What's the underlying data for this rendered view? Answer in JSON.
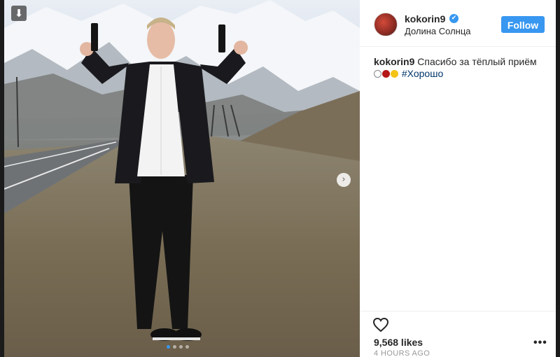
{
  "post": {
    "username": "kokorin9",
    "location": "Долина Солнца",
    "follow_label": "Follow",
    "verified_icon": "✔",
    "caption": {
      "username": "kokorin9",
      "text": "Спасибо за тёплый приём",
      "emoji": [
        "white-circle",
        "red-circle",
        "yellow-circle"
      ],
      "hashtag": "#Хорошо"
    },
    "likes": "9,568 likes",
    "timestamp": "4 HOURS AGO",
    "more_label": "•••"
  },
  "photo": {
    "save_icon": "⬇",
    "next_icon": "›",
    "carousel_dots": 4,
    "active_dot": 0
  },
  "colors": {
    "accent": "#3897f0",
    "text": "#262626",
    "muted": "#999999",
    "hashtag": "#003569"
  }
}
